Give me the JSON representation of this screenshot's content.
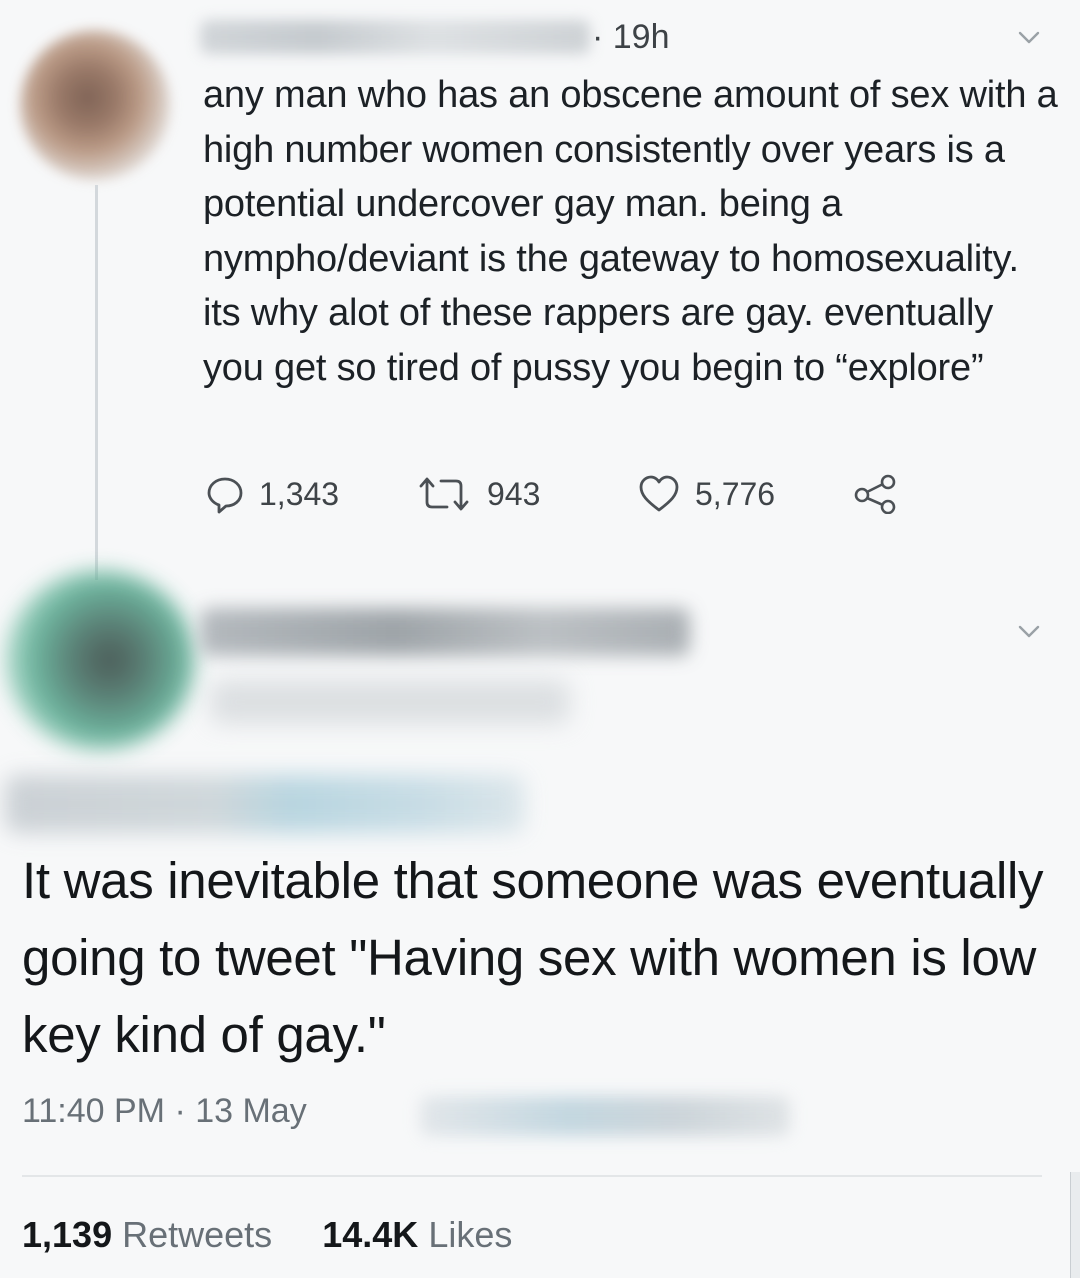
{
  "reply_tweet": {
    "time": "· 19h",
    "text": "any man who has an obscene amount of sex with a high number women consistently over years is a potential undercover gay man. being a nympho/deviant is the gateway to homosexuality. its why alot of these rappers are gay. eventually you get so tired of pussy you begin to “explore”",
    "replies": "1,343",
    "retweets": "943",
    "likes": "5,776"
  },
  "quote_tweet": {
    "text": "It was inevitable that someone was eventually going to tweet \"Having sex with women is low key kind of gay.\"",
    "timestamp": "11:40 PM · 13 May",
    "retweet_count": "1,139",
    "retweet_label": "Retweets",
    "like_count": "14.4K",
    "like_label": "Likes"
  },
  "icons": {
    "reply": "reply-icon",
    "retweet": "retweet-icon",
    "like": "heart-icon",
    "share": "share-icon",
    "menu": "chevron-down-icon"
  },
  "colors": {
    "text": "#14171a",
    "secondary": "#687077",
    "background": "#f7f8f9"
  }
}
